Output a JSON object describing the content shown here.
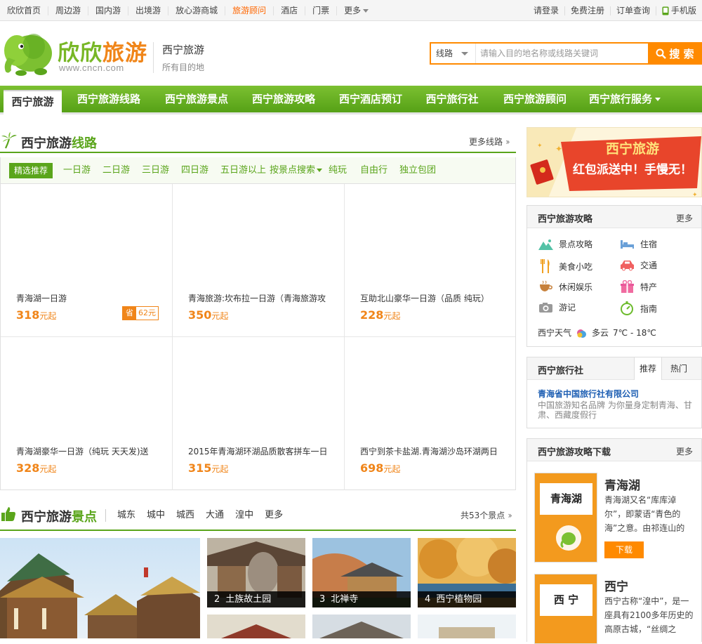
{
  "topbar": {
    "left": [
      "欣欣首页",
      "周边游",
      "国内游",
      "出境游",
      "放心游商城",
      "旅游顾问",
      "酒店",
      "门票",
      "更多"
    ],
    "right": [
      "请登录",
      "免费注册",
      "订单查询",
      "手机版"
    ]
  },
  "header": {
    "brand": "欣欣旅游",
    "brand_url": "www.cncn.com",
    "city_title": "西宁旅游",
    "city_sub": "所有目的地",
    "search_type": "线路",
    "search_placeholder": "请输入目的地名称或线路关键词",
    "search_button": "搜 索"
  },
  "mainnav": [
    "西宁旅游",
    "西宁旅游线路",
    "西宁旅游景点",
    "西宁旅游攻略",
    "西宁酒店预订",
    "西宁旅行社",
    "西宁旅游顾问",
    "西宁旅行服务"
  ],
  "routes": {
    "title_a": "西宁旅游",
    "title_b": "线路",
    "more": "更多线路",
    "tabs": [
      "精选推荐",
      "一日游",
      "二日游",
      "三日游",
      "四日游",
      "五日游以上",
      "按景点搜索",
      "纯玩",
      "自由行",
      "独立包团"
    ],
    "items": [
      {
        "name": "青海湖一日游",
        "price": "318",
        "unit": "元起",
        "save_label": "省",
        "save": "62元"
      },
      {
        "name": "青海旅游:坎布拉一日游（青海旅游攻",
        "price": "350",
        "unit": "元起"
      },
      {
        "name": "互助北山豪华一日游（品质 纯玩）",
        "price": "228",
        "unit": "元起"
      },
      {
        "name": "青海湖豪华一日游（纯玩 天天发)送",
        "price": "328",
        "unit": "元起"
      },
      {
        "name": "2015年青海湖环湖品质散客拼车一日",
        "price": "315",
        "unit": "元起"
      },
      {
        "name": "西宁到茶卡盐湖.青海湖沙岛环湖两日",
        "price": "698",
        "unit": "元起"
      }
    ]
  },
  "spots": {
    "title_a": "西宁旅游",
    "title_b": "景点",
    "tabs": [
      "城东",
      "城中",
      "城西",
      "大通",
      "湟中",
      "更多"
    ],
    "more": "共53个景点",
    "photos": [
      {
        "num": "2",
        "name": "土族故土园"
      },
      {
        "num": "3",
        "name": "北禅寺"
      },
      {
        "num": "4",
        "name": "西宁植物园"
      }
    ]
  },
  "banner": {
    "line1": "西宁旅游",
    "line2": "红包派送中！手慢无！"
  },
  "guide": {
    "title": "西宁旅游攻略",
    "more": "更多",
    "items": [
      {
        "label": "景点攻略",
        "icon": "mountain-icon"
      },
      {
        "label": "住宿",
        "icon": "bed-icon"
      },
      {
        "label": "美食小吃",
        "icon": "fork-knife-icon"
      },
      {
        "label": "交通",
        "icon": "car-icon"
      },
      {
        "label": "休闲娱乐",
        "icon": "coffee-icon"
      },
      {
        "label": "特产",
        "icon": "gift-icon"
      },
      {
        "label": "游记",
        "icon": "camera-icon"
      },
      {
        "label": "指南",
        "icon": "compass-icon"
      }
    ],
    "weather_label": "西宁天气",
    "weather_desc": "多云",
    "weather_temp": "7℃ - 18℃"
  },
  "agency": {
    "title": "西宁旅行社",
    "tabs": [
      "推荐",
      "热门"
    ],
    "name": "青海省中国旅行社有限公司",
    "desc": "中国旅游知名品牌 为你量身定制青海、甘肃、西藏度假行"
  },
  "download": {
    "title": "西宁旅游攻略下载",
    "more": "更多",
    "items": [
      {
        "cover": "青海湖",
        "title": "青海湖",
        "desc": "青海湖又名“库库淖尔”，即蒙语“青色的海”之意。由祁连山的",
        "button": "下载"
      },
      {
        "cover": "西 宁",
        "title": "西宁",
        "desc": "西宁古称“湟中”，是一座具有2100多年历史的高原古城，“丝绸之"
      }
    ]
  },
  "colors": {
    "green": "#5aa51b",
    "orange": "#f08519",
    "search_orange": "#ff8a00",
    "red_banner": "#e8452b"
  }
}
